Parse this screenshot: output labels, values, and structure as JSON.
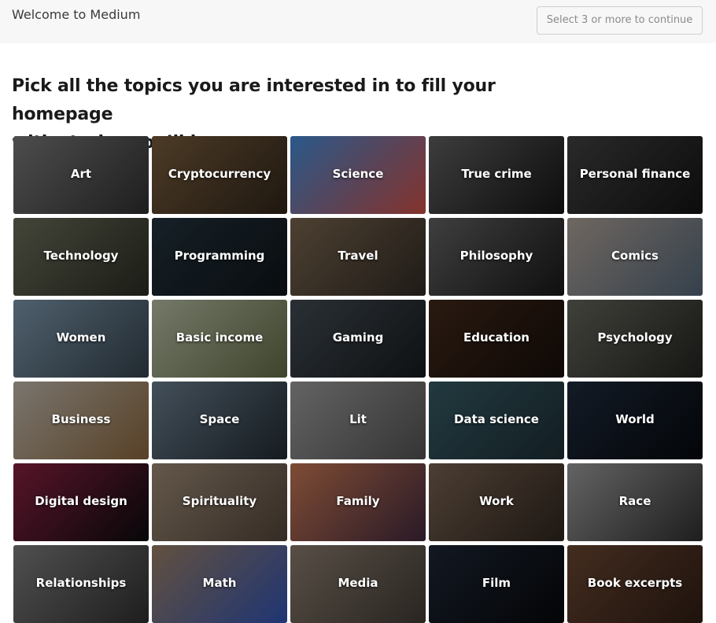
{
  "header": {
    "title": "Welcome to Medium",
    "continue_label": "Select 3 or more to continue"
  },
  "headline": {
    "line1": "Pick all the topics you are interested in to fill your homepage",
    "line2": "with stories you’ll love."
  },
  "topics": [
    {
      "label": "Art",
      "color": "#6b6b6b",
      "color2": "#2a2a2a"
    },
    {
      "label": "Cryptocurrency",
      "color": "#6a5236",
      "color2": "#2b2117"
    },
    {
      "label": "Science",
      "color": "#3b7bbf",
      "color2": "#b8463d"
    },
    {
      "label": "True crime",
      "color": "#555555",
      "color2": "#121212"
    },
    {
      "label": "Personal finance",
      "color": "#3a3a3a",
      "color2": "#111111"
    },
    {
      "label": "Technology",
      "color": "#5f6150",
      "color2": "#26281f"
    },
    {
      "label": "Programming",
      "color": "#1f2d36",
      "color2": "#0d1216"
    },
    {
      "label": "Travel",
      "color": "#6b5a45",
      "color2": "#2c2621"
    },
    {
      "label": "Philosophy",
      "color": "#575757",
      "color2": "#161616"
    },
    {
      "label": "Comics",
      "color": "#9a8f86",
      "color2": "#4a5a6a"
    },
    {
      "label": "Women",
      "color": "#6e8698",
      "color2": "#2f3b44"
    },
    {
      "label": "Basic income",
      "color": "#a2a892",
      "color2": "#57603e"
    },
    {
      "label": "Gaming",
      "color": "#3b434a",
      "color2": "#14181b"
    },
    {
      "label": "Education",
      "color": "#3a2418",
      "color2": "#140c08"
    },
    {
      "label": "Psychology",
      "color": "#5a5a52",
      "color2": "#1f1f1c"
    },
    {
      "label": "Business",
      "color": "#a9a399",
      "color2": "#7a5a36"
    },
    {
      "label": "Space",
      "color": "#5d6e7c",
      "color2": "#1e262d"
    },
    {
      "label": "Lit",
      "color": "#8a8a8a",
      "color2": "#4a4a4a"
    },
    {
      "label": "Data science",
      "color": "#2f5058",
      "color2": "#1a2a30"
    },
    {
      "label": "World",
      "color": "#1b2636",
      "color2": "#05080c"
    },
    {
      "label": "Digital design",
      "color": "#7a1d3a",
      "color2": "#0a0a0c"
    },
    {
      "label": "Spirituality",
      "color": "#8b7a68",
      "color2": "#4a3d33"
    },
    {
      "label": "Family",
      "color": "#b06a4a",
      "color2": "#3a2436"
    },
    {
      "label": "Work",
      "color": "#6a5748",
      "color2": "#2a211b"
    },
    {
      "label": "Race",
      "color": "#8a8a8a",
      "color2": "#2a2a2a"
    },
    {
      "label": "Relationships",
      "color": "#6f6f6f",
      "color2": "#2a2a2a"
    },
    {
      "label": "Math",
      "color": "#8a7058",
      "color2": "#2b4aa0"
    },
    {
      "label": "Media",
      "color": "#7a6e62",
      "color2": "#3a342e"
    },
    {
      "label": "Film",
      "color": "#1a2230",
      "color2": "#060709"
    },
    {
      "label": "Book excerpts",
      "color": "#5e3e2c",
      "color2": "#2a1a12"
    }
  ]
}
